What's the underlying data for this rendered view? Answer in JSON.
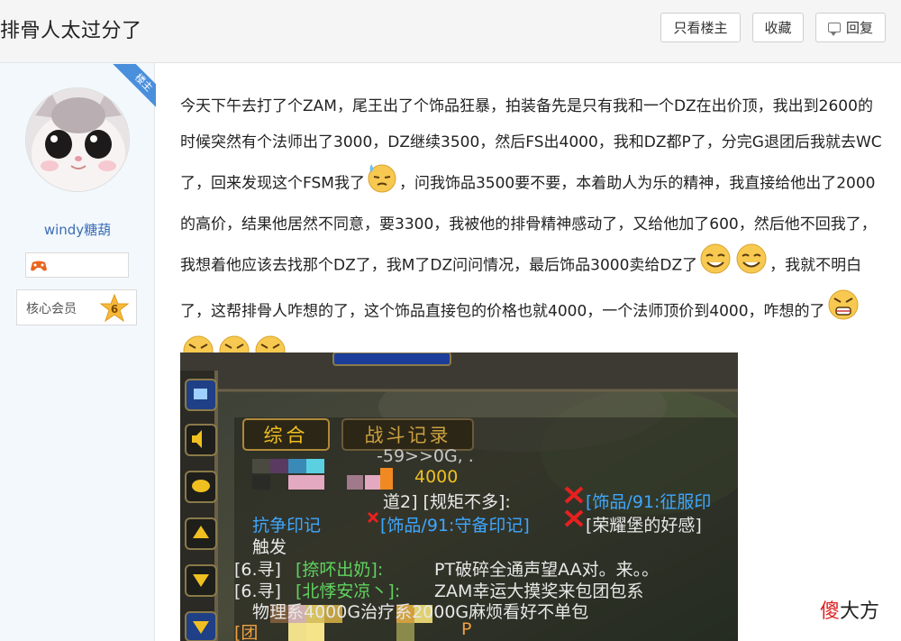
{
  "header": {
    "title": "排骨人太过分了",
    "only_owner_label": "只看楼主",
    "favorite_label": "收藏",
    "reply_label": "回复"
  },
  "sidebar": {
    "ribbon_label": "楼主",
    "username": "windy糖葫",
    "member_label": "核心会员",
    "level": "6"
  },
  "post": {
    "p1": "今天下午去打了个ZAM，尾王出了个饰品狂暴，拍装备先是只有我和一个DZ在出价顶，我出到2600的时候突然有个法师出了3000，DZ继续3500，然后FS出4000，我和DZ都P了，分完G退团后我就去WC了，回来发现这个FSM我了",
    "p2": "，问我饰品3500要不要，本着助人为乐的精神，我直接给他出了2000的高价，结果他居然不同意，要3300，我被他的排骨精神感动了，又给他加了600，然后他不回我了，我想着他应该去找那个DZ了，我M了DZ问问情况，最后饰品3000卖给DZ了",
    "p3": "，我就不明白了，这帮排骨人咋想的了，这个饰品直接包的价格也就4000，一个法师顶价到4000，咋想的了"
  },
  "game": {
    "tab1": "综合",
    "tab2": "战斗记录",
    "gold_line": "-59>>0G, .",
    "bid": "4000",
    "line1_a": "道2] [规矩不多]:",
    "line1_b": "[饰品/91:征服印",
    "line2_a": "抗争印记",
    "line2_b": "[饰品/91:守备印记]",
    "line2_c": "[荣耀堡的好感]",
    "line3": "触发",
    "line4_ch": "[6.寻]",
    "line4_name": "[捺吥出奶]:",
    "line4_msg": "PT破碎全通声望AA对。来。。",
    "line5_ch": "[6.寻]",
    "line5_name": "[北悸安凉丶]:",
    "line5_msg": "ZAM幸运大摸奖来包团包系",
    "line6": "物理系4000G治疗系2000G麻烦看好不单包",
    "line7_a": "[团",
    "line7_b": "P"
  },
  "watermark": {
    "red_char": "傻",
    "rest": "大方"
  },
  "colors": {
    "ribbon": "#4a8fdb",
    "username": "#3a6db5",
    "game_gold": "#f0c020",
    "game_green": "#5fd35f",
    "game_blue": "#3ea7ff"
  }
}
